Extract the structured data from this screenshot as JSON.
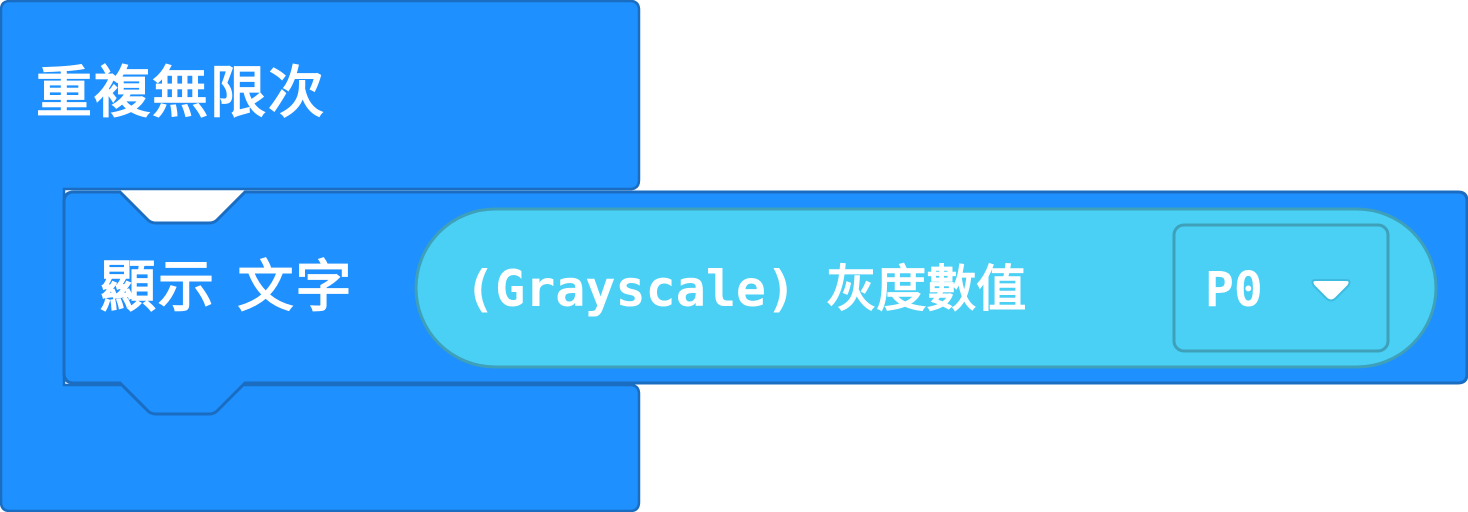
{
  "forever_block": {
    "label": "重複無限次"
  },
  "show_string_block": {
    "label": "顯示 文字"
  },
  "grayscale_reporter": {
    "label": "(Grayscale) 灰度數值",
    "pin_dropdown": {
      "selected": "P0"
    }
  },
  "colors": {
    "block_blue": "#1E90FF",
    "block_border": "#1B6DC1",
    "reporter": "#4ACFF5",
    "reporter_border": "#3EA0B9"
  }
}
